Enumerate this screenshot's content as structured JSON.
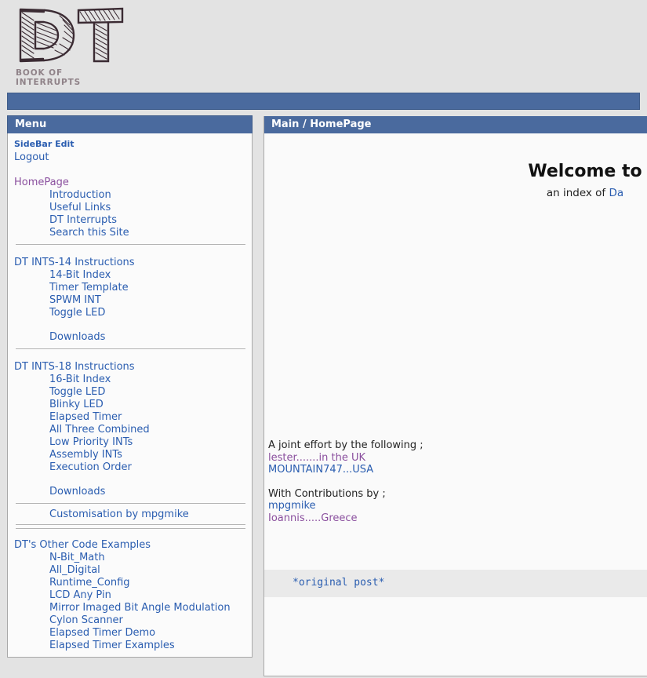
{
  "site": {
    "logo_letters": "DT",
    "logo_subtitle": "BOOK OF INTERRUPTS"
  },
  "colors": {
    "header_blue": "#4a6a9e",
    "header_blue_border": "#3f5c8a",
    "link_blue": "#2a5db0",
    "link_visited_purple": "#8a4f9e",
    "page_background": "#e3e3e3",
    "panel_background": "#fbfbfb",
    "code_background": "#eaeaea",
    "rule_gray": "#b4b4b4",
    "logo_subtitle_gray": "#8f8288"
  },
  "sidebar": {
    "title": "Menu",
    "account_links": [
      {
        "label": "SideBar Edit",
        "style": "small"
      },
      {
        "label": "Logout",
        "style": "normal"
      }
    ],
    "groups": [
      {
        "heading": {
          "label": "HomePage",
          "visited": true
        },
        "items": [
          {
            "label": "Introduction"
          },
          {
            "label": "Useful Links"
          },
          {
            "label": "DT Interrupts"
          },
          {
            "label": "Search this Site"
          }
        ]
      },
      {
        "heading": {
          "label": "DT INTS-14 Instructions",
          "visited": false
        },
        "items": [
          {
            "label": "14-Bit Index"
          },
          {
            "label": "Timer Template"
          },
          {
            "label": "SPWM INT"
          },
          {
            "label": "Toggle LED"
          }
        ],
        "extra": [
          {
            "label": "Downloads"
          }
        ]
      },
      {
        "heading": {
          "label": "DT INTS-18 Instructions",
          "visited": false
        },
        "items": [
          {
            "label": "16-Bit Index"
          },
          {
            "label": "Toggle LED"
          },
          {
            "label": "Blinky LED"
          },
          {
            "label": "Elapsed Timer"
          },
          {
            "label": "All Three Combined"
          },
          {
            "label": "Low Priority INTs"
          },
          {
            "label": "Assembly INTs"
          },
          {
            "label": "Execution Order"
          }
        ],
        "extra": [
          {
            "label": "Downloads"
          }
        ]
      }
    ],
    "customisation": {
      "label": "Customisation by mpgmike"
    },
    "other_examples": {
      "heading": {
        "label": "DT's Other Code Examples",
        "visited": false
      },
      "items": [
        {
          "label": "N-Bit_Math"
        },
        {
          "label": "All_Digital"
        },
        {
          "label": "Runtime_Config"
        },
        {
          "label": "LCD Any Pin"
        },
        {
          "label": "Mirror Imaged Bit Angle Modulation"
        },
        {
          "label": "Cylon Scanner"
        },
        {
          "label": "Elapsed Timer Demo"
        },
        {
          "label": "Elapsed Timer Examples"
        }
      ]
    }
  },
  "main": {
    "breadcrumb": "Main / HomePage",
    "breadcrumb_parent": "Main",
    "breadcrumb_separator": "/",
    "breadcrumb_page": "HomePage",
    "welcome_heading": "Welcome to",
    "welcome_subtitle_prefix": "an index of ",
    "welcome_subtitle_link": "Da",
    "credits": {
      "joint_effort_label": "A joint effort by the following ;",
      "joint_effort_people": [
        {
          "label": "lester.......in the UK",
          "visited": true
        },
        {
          "label": "MOUNTAIN747...USA",
          "visited": false
        }
      ],
      "contributions_label": "With Contributions by ;",
      "contributions_people": [
        {
          "label": "mpgmike",
          "visited": false
        },
        {
          "label": "Ioannis.....Greece",
          "visited": true
        }
      ]
    },
    "code_block": {
      "line": "*original post*"
    }
  }
}
